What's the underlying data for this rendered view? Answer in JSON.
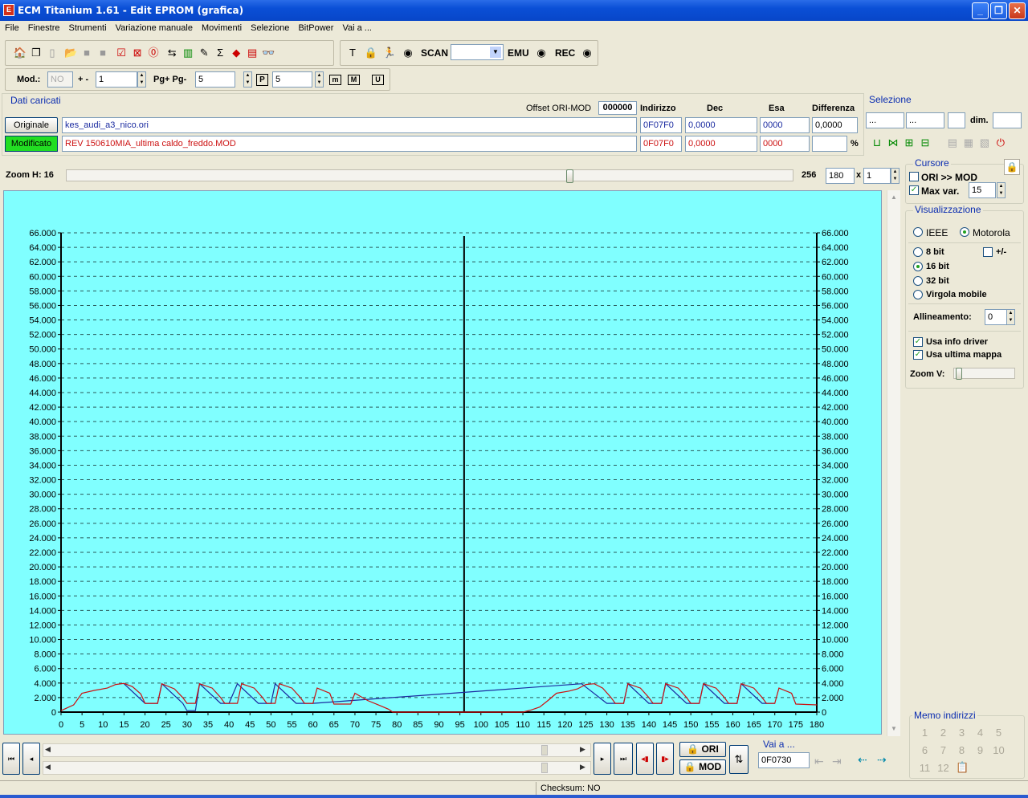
{
  "window": {
    "title": "ECM Titanium 1.61 - Edit EPROM (grafica)",
    "app_icon": "E"
  },
  "menu": [
    "File",
    "Finestre",
    "Strumenti",
    "Variazione manuale",
    "Movimenti",
    "Selezione",
    "BitPower",
    "Vai a ..."
  ],
  "toolbar": {
    "scan_label": "SCAN",
    "emu_label": "EMU",
    "rec_label": "REC",
    "scan_value": ""
  },
  "toolbar2": {
    "mod_label": "Mod.:",
    "mod_value": "NO",
    "plusminus_label": "+ -",
    "plusminus_value": "1",
    "pg_label": "Pg+ Pg-",
    "pg_value": "5",
    "p_value": "5",
    "p_icon": "P",
    "m_icon": "m",
    "M_icon": "M",
    "u_icon": "U"
  },
  "dati": {
    "title": "Dati caricati",
    "offset_label": "Offset ORI-MOD",
    "offset_value": "000000",
    "col_indirizzo": "Indirizzo",
    "col_dec": "Dec",
    "col_esa": "Esa",
    "col_diff": "Differenza",
    "ori_button": "Originale",
    "mod_button": "Modificato",
    "ori_file": "kes_audi_a3_nico.ori",
    "mod_file": "REV 150610MIA_ultima caldo_freddo.MOD",
    "ori_addr": "0F07F0",
    "ori_dec": "0,0000",
    "ori_esa": "0000",
    "ori_diff": "0,0000",
    "mod_addr": "0F07F0",
    "mod_dec": "0,0000",
    "mod_esa": "0000",
    "mod_diff": "",
    "percent": "%"
  },
  "selezione": {
    "title": "Selezione",
    "from": "...",
    "to": "...",
    "dim_label": "dim.",
    "dim_value": ""
  },
  "zoom": {
    "label": "Zoom H: 16",
    "max": "256",
    "value": "180",
    "x_label": "x",
    "mult": "1",
    "slider_fraction": 0.6953
  },
  "cursore": {
    "title": "Cursore",
    "ori_mod_label": "ORI >> MOD",
    "ori_mod_checked": false,
    "max_var_label": "Max var.",
    "max_var_checked": true,
    "max_var_value": "15",
    "check": "✓"
  },
  "visual": {
    "title": "Visualizzazione",
    "ieee": "IEEE",
    "motorola": "Motorola",
    "b8": "8 bit",
    "b16": "16 bit",
    "b32": "32 bit",
    "virgola": "Virgola mobile",
    "pm": "+/-",
    "allineamento_label": "Allineamento:",
    "allineamento_value": "0",
    "usa_info": "Usa info driver",
    "usa_ultima": "Usa ultima mappa",
    "zoomv_label": "Zoom V:"
  },
  "memo": {
    "title": "Memo indirizzi",
    "items": [
      "1",
      "2",
      "3",
      "4",
      "5",
      "6",
      "7",
      "8",
      "9",
      "10",
      "11",
      "12"
    ]
  },
  "nav": {
    "ori_label": "ORI",
    "mod_label": "MOD",
    "vai_label": "Vai a ...",
    "vai_value": "0F0730"
  },
  "status": {
    "checksum": "Checksum: NO"
  },
  "colors": {
    "plot_bg": "#80ffff",
    "ori": "#1a2aa0",
    "mod": "#cc1010",
    "accent": "#0a2cb0",
    "mod_btn": "#22dd22"
  },
  "chart_data": {
    "type": "line",
    "ylim": [
      0,
      66000
    ],
    "xlim": [
      0,
      180
    ],
    "y_ticks": [
      "0",
      "2.000",
      "4.000",
      "6.000",
      "8.000",
      "10.000",
      "12.000",
      "14.000",
      "16.000",
      "18.000",
      "20.000",
      "22.000",
      "24.000",
      "26.000",
      "28.000",
      "30.000",
      "32.000",
      "34.000",
      "36.000",
      "38.000",
      "40.000",
      "42.000",
      "44.000",
      "46.000",
      "48.000",
      "50.000",
      "52.000",
      "54.000",
      "56.000",
      "58.000",
      "60.000",
      "62.000",
      "64.000",
      "66.000"
    ],
    "x_ticks": [
      "0",
      "5",
      "10",
      "15",
      "20",
      "25",
      "30",
      "35",
      "40",
      "45",
      "50",
      "55",
      "60",
      "65",
      "70",
      "75",
      "80",
      "85",
      "90",
      "95",
      "100",
      "105",
      "110",
      "115",
      "120",
      "125",
      "130",
      "135",
      "140",
      "145",
      "150",
      "155",
      "160",
      "165",
      "170",
      "175",
      "180"
    ],
    "grid": true,
    "cursor_x": 96,
    "series": [
      {
        "color": "#1a2aa0",
        "points": [
          [
            15,
            3900
          ],
          [
            20,
            1200
          ],
          [
            23,
            1200
          ],
          [
            24,
            3900
          ],
          [
            29,
            1200
          ],
          [
            30,
            200
          ],
          [
            32,
            200
          ],
          [
            33,
            3900
          ],
          [
            38,
            1200
          ],
          [
            40,
            1200
          ],
          [
            42,
            3900
          ],
          [
            47,
            1200
          ],
          [
            50,
            1200
          ],
          [
            51,
            3900
          ],
          [
            56,
            1200
          ],
          [
            60,
            1200
          ],
          [
            124,
            3900
          ],
          [
            130,
            1200
          ],
          [
            134,
            1200
          ],
          [
            135,
            3900
          ],
          [
            140,
            1200
          ],
          [
            143,
            1200
          ],
          [
            144,
            3900
          ],
          [
            149,
            1200
          ],
          [
            152,
            1200
          ],
          [
            153,
            3900
          ],
          [
            158,
            1200
          ],
          [
            161,
            1200
          ],
          [
            162,
            3900
          ],
          [
            167,
            1200
          ],
          [
            170,
            1200
          ]
        ]
      },
      {
        "color": "#cc1010",
        "points": [
          [
            0,
            200
          ],
          [
            3,
            1000
          ],
          [
            5,
            2600
          ],
          [
            8,
            3000
          ],
          [
            11,
            3300
          ],
          [
            13,
            3800
          ],
          [
            15,
            3950
          ],
          [
            17,
            3500
          ],
          [
            19,
            2500
          ],
          [
            20,
            1200
          ],
          [
            23,
            1200
          ],
          [
            24,
            3900
          ],
          [
            27,
            3200
          ],
          [
            29,
            2000
          ],
          [
            30,
            1200
          ],
          [
            32,
            1200
          ],
          [
            33,
            3900
          ],
          [
            36,
            3300
          ],
          [
            38,
            2000
          ],
          [
            39,
            1200
          ],
          [
            42,
            1200
          ],
          [
            43,
            3900
          ],
          [
            46,
            3300
          ],
          [
            48,
            2000
          ],
          [
            49,
            1200
          ],
          [
            51,
            1200
          ],
          [
            52,
            3900
          ],
          [
            55,
            3300
          ],
          [
            57,
            2000
          ],
          [
            58,
            1200
          ],
          [
            60,
            1200
          ],
          [
            61,
            3300
          ],
          [
            64,
            2600
          ],
          [
            65,
            1100
          ],
          [
            69,
            1100
          ],
          [
            70,
            2600
          ],
          [
            73,
            1600
          ],
          [
            76,
            900
          ],
          [
            78,
            400
          ],
          [
            79,
            0
          ],
          [
            110,
            0
          ],
          [
            112,
            300
          ],
          [
            114,
            700
          ],
          [
            116,
            1600
          ],
          [
            118,
            2600
          ],
          [
            121,
            2900
          ],
          [
            123,
            3200
          ],
          [
            125,
            3800
          ],
          [
            127,
            3900
          ],
          [
            129,
            3300
          ],
          [
            131,
            2000
          ],
          [
            132,
            1200
          ],
          [
            134,
            1200
          ],
          [
            135,
            3900
          ],
          [
            138,
            3300
          ],
          [
            140,
            2000
          ],
          [
            141,
            1200
          ],
          [
            143,
            1200
          ],
          [
            144,
            3900
          ],
          [
            147,
            3300
          ],
          [
            149,
            2000
          ],
          [
            150,
            1200
          ],
          [
            152,
            1200
          ],
          [
            153,
            3900
          ],
          [
            156,
            3300
          ],
          [
            158,
            2000
          ],
          [
            159,
            1200
          ],
          [
            161,
            1200
          ],
          [
            162,
            3900
          ],
          [
            165,
            3300
          ],
          [
            167,
            2000
          ],
          [
            168,
            1200
          ],
          [
            170,
            1200
          ],
          [
            171,
            3300
          ],
          [
            174,
            2600
          ],
          [
            175,
            1100
          ],
          [
            180,
            1000
          ]
        ]
      }
    ]
  }
}
